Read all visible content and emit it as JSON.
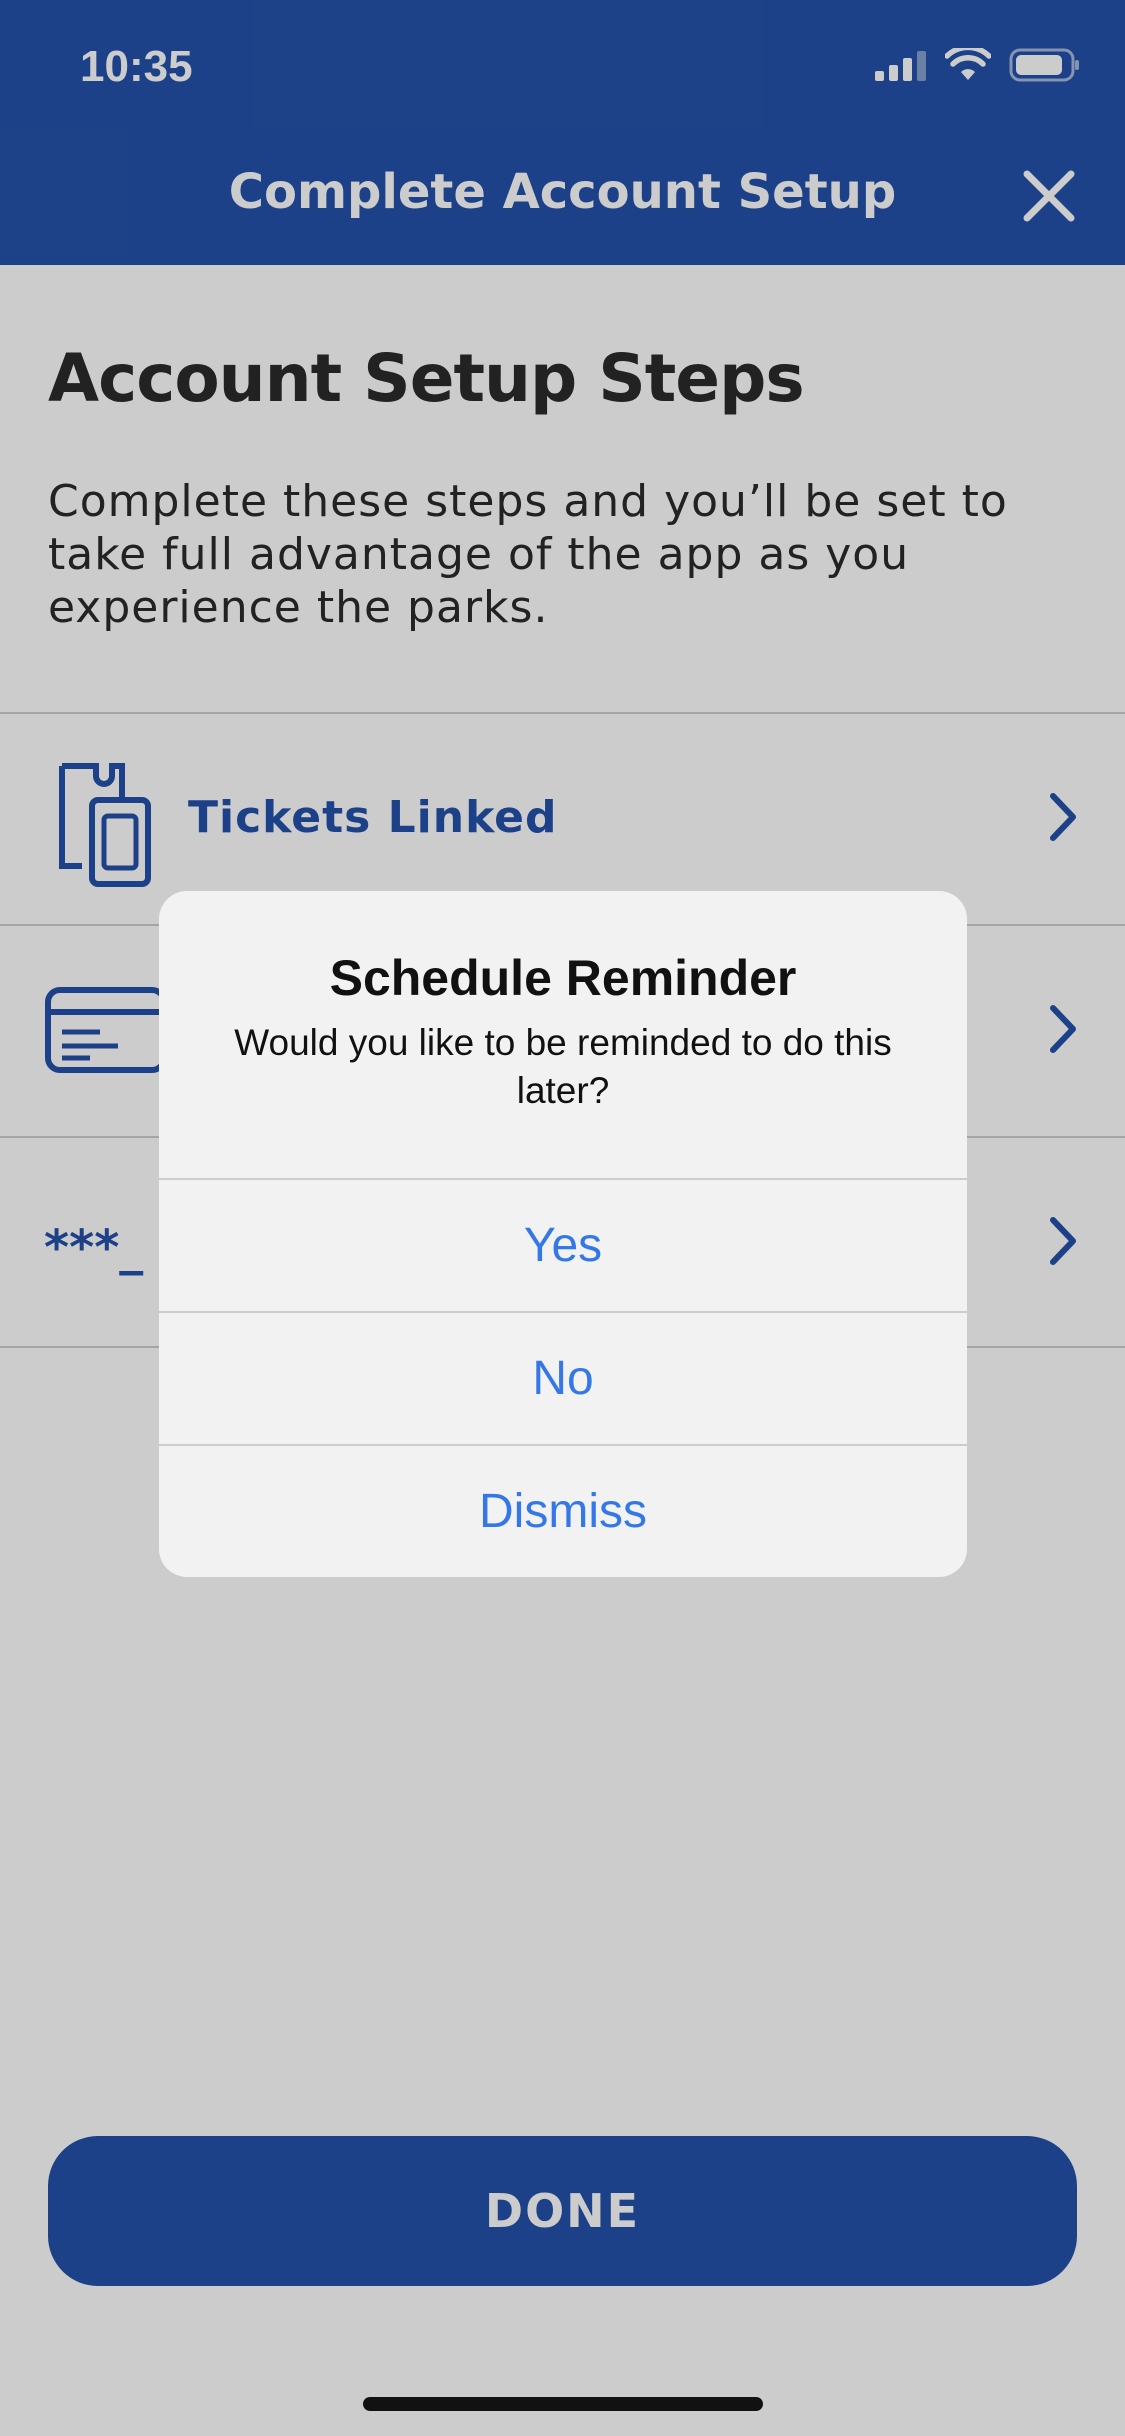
{
  "status_bar": {
    "time": "10:35"
  },
  "nav": {
    "title": "Complete Account Setup"
  },
  "main": {
    "title": "Account Setup Steps",
    "intro": "Complete these steps and you’ll be set to take full advantage of the app as you experience the parks.",
    "steps": [
      {
        "label": "Tickets Linked",
        "icon": "ticket-icon"
      },
      {
        "label": "",
        "icon": "credit-card-icon"
      },
      {
        "label": "***_",
        "icon": "password-icon"
      }
    ]
  },
  "done_label": "DONE",
  "alert": {
    "title": "Schedule Reminder",
    "message": "Would you like to be reminded to do this later?",
    "buttons": [
      "Yes",
      "No",
      "Dismiss"
    ]
  },
  "colors": {
    "brand": "#2452aa",
    "ios_link": "#3478e8"
  }
}
